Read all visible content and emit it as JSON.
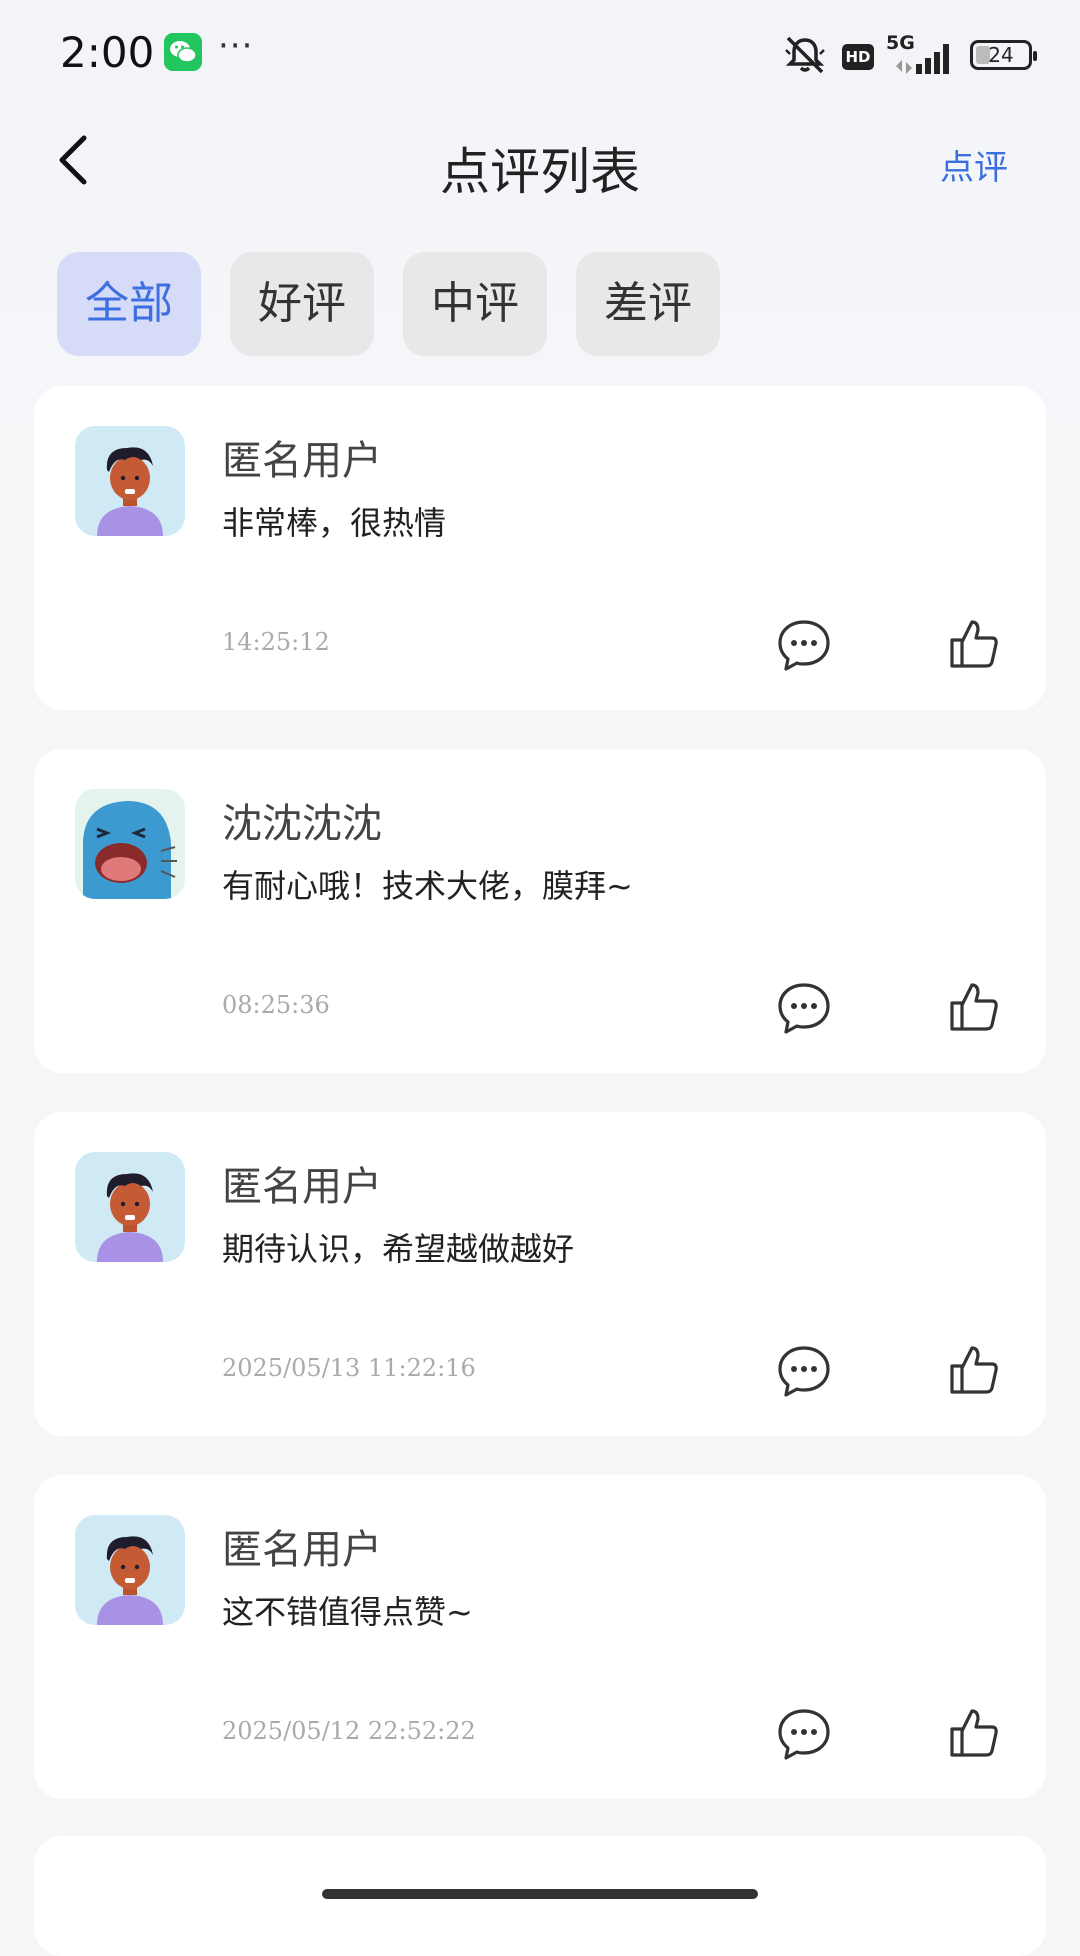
{
  "status_bar": {
    "time": "2:00",
    "more": "···",
    "hd": "HD",
    "network": "5G",
    "battery": "24"
  },
  "nav": {
    "title": "点评列表",
    "action_label": "点评"
  },
  "tabs": [
    {
      "label": "全部",
      "active": true
    },
    {
      "label": "好评",
      "active": false
    },
    {
      "label": "中评",
      "active": false
    },
    {
      "label": "差评",
      "active": false
    }
  ],
  "reviews": [
    {
      "name": "匿名用户",
      "text": "非常棒，很热情",
      "time": "14:25:12",
      "avatar": "person-avatar"
    },
    {
      "name": "沈沈沈沈",
      "text": "有耐心哦！技术大佬，膜拜~",
      "time": "08:25:36",
      "avatar": "blob-avatar"
    },
    {
      "name": "匿名用户",
      "text": "期待认识，希望越做越好",
      "time": "2025/05/13 11:22:16",
      "avatar": "person-avatar"
    },
    {
      "name": "匿名用户",
      "text": "这不错值得点赞~",
      "time": "2025/05/12 22:52:22",
      "avatar": "person-avatar"
    }
  ],
  "colors": {
    "accent": "#3b6fe0",
    "active_tab_bg": "#d6dcf7",
    "tab_bg": "#e8e8e8",
    "page_bg": "#f5f6f8"
  }
}
